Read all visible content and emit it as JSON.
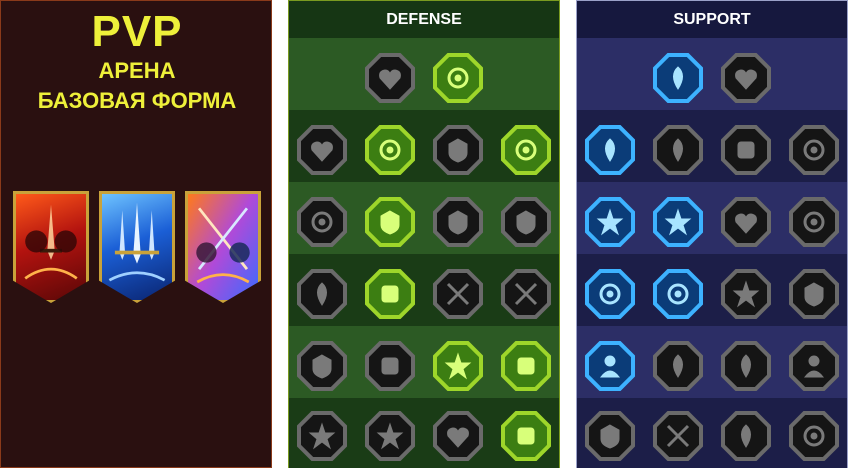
{
  "left": {
    "title": "PVP",
    "subtitle_1": "АРЕНА",
    "subtitle_2": "БАЗОВАЯ ФОРМА",
    "banners": [
      "red-warrior-banner",
      "blue-knight-banner",
      "mixed-duel-banner"
    ]
  },
  "defense": {
    "header": "DEFENSE",
    "rows": [
      [
        {
          "icon": "armor-plates-icon",
          "style": "gray"
        },
        {
          "icon": "raised-fist-icon",
          "style": "green"
        }
      ],
      [
        {
          "icon": "chevron-shield-icon",
          "style": "gray"
        },
        {
          "icon": "potion-flask-icon",
          "style": "green"
        },
        {
          "icon": "muscle-body-icon",
          "style": "gray"
        },
        {
          "icon": "crossed-blades-icon",
          "style": "green"
        }
      ],
      [
        {
          "icon": "fighter-pose-icon",
          "style": "gray"
        },
        {
          "icon": "shield-warrior-icon",
          "style": "green"
        },
        {
          "icon": "broken-heart-icon",
          "style": "gray"
        },
        {
          "icon": "hooded-figure-icon",
          "style": "gray"
        }
      ],
      [
        {
          "icon": "crowd-figures-icon",
          "style": "gray"
        },
        {
          "icon": "hourglass-icon",
          "style": "green"
        },
        {
          "icon": "open-hand-icon",
          "style": "gray"
        },
        {
          "icon": "bull-head-icon",
          "style": "gray"
        }
      ],
      [
        {
          "icon": "speed-runner-icon",
          "style": "gray"
        },
        {
          "icon": "claw-marks-icon",
          "style": "gray"
        },
        {
          "icon": "sun-skull-icon",
          "style": "green"
        },
        {
          "icon": "slash-circle-icon",
          "style": "green"
        }
      ],
      [
        {
          "icon": "armored-knight-icon",
          "style": "gray"
        },
        {
          "icon": "winged-shield-icon",
          "style": "gray"
        },
        {
          "icon": "bearded-face-icon",
          "style": "gray"
        },
        {
          "icon": "flexing-figure-icon",
          "style": "green"
        }
      ]
    ]
  },
  "support": {
    "header": "SUPPORT",
    "rows": [
      [
        {
          "icon": "sparkle-heart-icon",
          "style": "blue"
        },
        {
          "icon": "swirl-chain-icon",
          "style": "gray"
        }
      ],
      [
        {
          "icon": "praying-hands-icon",
          "style": "blue"
        },
        {
          "icon": "shield-aura-icon",
          "style": "gray"
        },
        {
          "icon": "flaming-skull-icon",
          "style": "gray"
        },
        {
          "icon": "speed-lines-icon",
          "style": "gray"
        }
      ],
      [
        {
          "icon": "glowing-figure-icon",
          "style": "blue"
        },
        {
          "icon": "lightning-shield-icon",
          "style": "blue"
        },
        {
          "icon": "cracked-ground-icon",
          "style": "gray"
        },
        {
          "icon": "shadow-figure-icon",
          "style": "gray"
        }
      ],
      [
        {
          "icon": "chained-heart-icon",
          "style": "blue"
        },
        {
          "icon": "fire-comet-icon",
          "style": "blue"
        },
        {
          "icon": "open-book-icon",
          "style": "gray"
        },
        {
          "icon": "burst-rays-icon",
          "style": "gray"
        }
      ],
      [
        {
          "icon": "compass-star-icon",
          "style": "blue"
        },
        {
          "icon": "boot-step-icon",
          "style": "gray"
        },
        {
          "icon": "watching-eye-icon",
          "style": "gray"
        },
        {
          "icon": "martial-kick-icon",
          "style": "gray"
        }
      ],
      [
        {
          "icon": "poison-flask-icon",
          "style": "gray"
        },
        {
          "icon": "horned-skull-icon",
          "style": "gray"
        },
        {
          "icon": "gauntlet-fist-icon",
          "style": "gray"
        },
        {
          "icon": "eagle-head-icon",
          "style": "gray"
        }
      ]
    ]
  }
}
